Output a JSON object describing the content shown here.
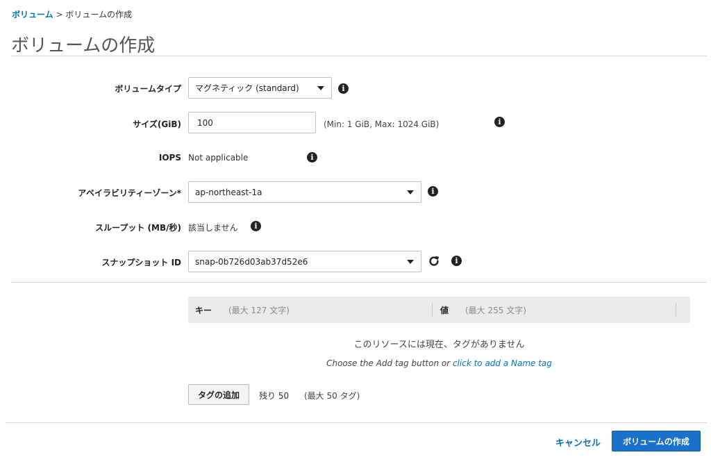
{
  "breadcrumb": {
    "parent": "ボリューム",
    "separator": " > ",
    "current": "ボリュームの作成"
  },
  "page_title": "ボリュームの作成",
  "form": {
    "volume_type": {
      "label": "ボリュームタイプ",
      "value": "マグネティック (standard)"
    },
    "size": {
      "label": "サイズ(GiB)",
      "value": "100",
      "hint": "(Min: 1 GiB, Max: 1024 GiB)"
    },
    "iops": {
      "label": "IOPS",
      "value": "Not applicable"
    },
    "availability_zone": {
      "label": "アベイラビリティーゾーン*",
      "value": "ap-northeast-1a"
    },
    "throughput": {
      "label": "スループット (MB/秒)",
      "value": "該当しません"
    },
    "snapshot_id": {
      "label": "スナップショット ID",
      "value": "snap-0b726d03ab37d52e6"
    }
  },
  "tags": {
    "key_header": "キー",
    "key_hint": "(最大 127 文字)",
    "value_header": "値",
    "value_hint": "(最大 255 文字)",
    "empty_message": "このリソースには現在、タグがありません",
    "hint_prefix": "Choose the Add tag button or ",
    "hint_link": "click to add a Name tag",
    "add_button": "タグの追加",
    "remaining": "残り 50",
    "max": "(最大 50 タグ)"
  },
  "footer": {
    "cancel": "キャンセル",
    "create": "ボリュームの作成"
  },
  "colors": {
    "link": "#0073bb",
    "primary_button": "#1a73c8",
    "tag_header_bg": "#e9ebed"
  }
}
